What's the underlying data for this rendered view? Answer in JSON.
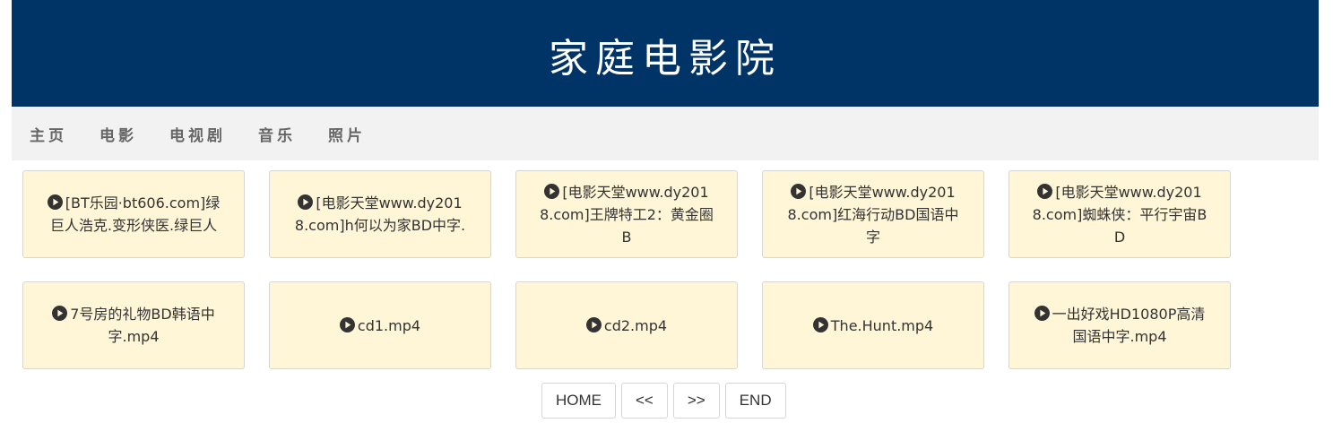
{
  "site": {
    "title": "家庭电影院",
    "header_bg": "#003366"
  },
  "nav": {
    "items": [
      {
        "label": "主页"
      },
      {
        "label": "电影"
      },
      {
        "label": "电视剧"
      },
      {
        "label": "音乐"
      },
      {
        "label": "照片"
      }
    ]
  },
  "videos": {
    "icon": "play-circle-icon",
    "card_bg": "#fff5d7",
    "items": [
      {
        "title": "[BT乐园·bt606.com]绿巨人浩克.变形侠医.绿巨人"
      },
      {
        "title": "[电影天堂www.dy2018.com]h何以为家BD中字."
      },
      {
        "title": "[电影天堂www.dy2018.com]王牌特工2：黄金圈B"
      },
      {
        "title": "[电影天堂www.dy2018.com]红海行动BD国语中字"
      },
      {
        "title": "[电影天堂www.dy2018.com]蜘蛛侠：平行宇宙BD"
      },
      {
        "title": "7号房的礼物BD韩语中字.mp4"
      },
      {
        "title": "cd1.mp4"
      },
      {
        "title": "cd2.mp4"
      },
      {
        "title": "The.Hunt.mp4"
      },
      {
        "title": "一出好戏HD1080P高清国语中字.mp4"
      }
    ]
  },
  "pager": {
    "home": "HOME",
    "prev": "<<",
    "next": ">>",
    "end": "END"
  }
}
